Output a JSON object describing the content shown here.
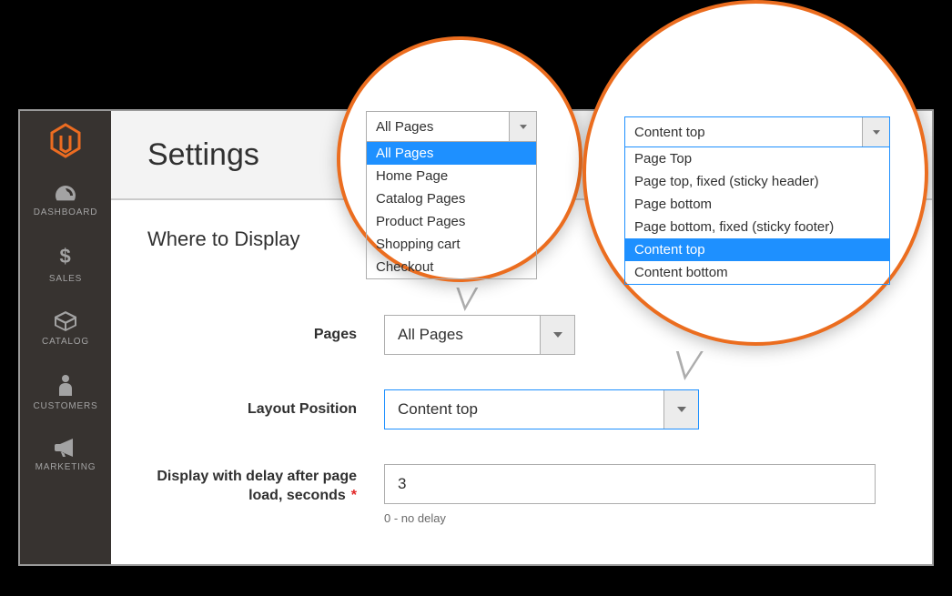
{
  "header": {
    "title": "Settings"
  },
  "sidebar": {
    "items": [
      {
        "label": "DASHBOARD"
      },
      {
        "label": "SALES"
      },
      {
        "label": "CATALOG"
      },
      {
        "label": "CUSTOMERS"
      },
      {
        "label": "MARKETING"
      }
    ]
  },
  "section": {
    "title": "Where to Display"
  },
  "fields": {
    "pages": {
      "label": "Pages",
      "value": "All Pages"
    },
    "layout": {
      "label": "Layout Position",
      "value": "Content top"
    },
    "delay": {
      "label": "Display with delay after page load, seconds",
      "value": "3",
      "hint": "0 - no delay"
    }
  },
  "dropdowns": {
    "pages": {
      "selected_text": "All Pages",
      "options": [
        "All Pages",
        "Home Page",
        "Catalog Pages",
        "Product Pages",
        "Shopping cart",
        "Checkout"
      ],
      "highlight_index": 0
    },
    "layout": {
      "selected_text": "Content top",
      "options": [
        "Page Top",
        "Page top, fixed (sticky header)",
        "Page bottom",
        "Page bottom, fixed (sticky footer)",
        "Content top",
        "Content bottom"
      ],
      "highlight_index": 4
    }
  }
}
